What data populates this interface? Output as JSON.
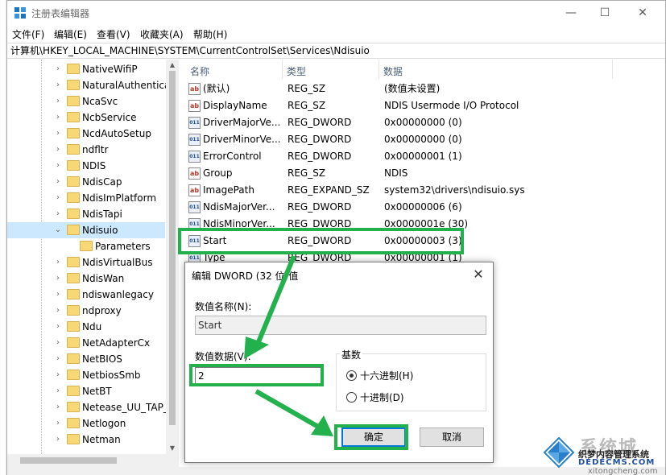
{
  "window": {
    "title": "注册表编辑器",
    "minimize_label": "—",
    "maximize_label": "☐",
    "close_label": "✕"
  },
  "menu": [
    "文件(F)",
    "编辑(E)",
    "查看(V)",
    "收藏夹(A)",
    "帮助(H)"
  ],
  "address": "计算机\\HKEY_LOCAL_MACHINE\\SYSTEM\\CurrentControlSet\\Services\\Ndisuio",
  "tree": {
    "items": [
      {
        "label": "NativeWifiP",
        "arrow": "›"
      },
      {
        "label": "NaturalAuthentica",
        "arrow": "›"
      },
      {
        "label": "NcaSvc",
        "arrow": "›"
      },
      {
        "label": "NcbService",
        "arrow": "›"
      },
      {
        "label": "NcdAutoSetup",
        "arrow": "›"
      },
      {
        "label": "ndfltr",
        "arrow": "›"
      },
      {
        "label": "NDIS",
        "arrow": "›"
      },
      {
        "label": "NdisCap",
        "arrow": "›"
      },
      {
        "label": "NdisImPlatform",
        "arrow": "›"
      },
      {
        "label": "NdisTapi",
        "arrow": "›"
      },
      {
        "label": "Ndisuio",
        "arrow": "⌄"
      },
      {
        "label": "Parameters",
        "arrow": ""
      },
      {
        "label": "NdisVirtualBus",
        "arrow": "›"
      },
      {
        "label": "NdisWan",
        "arrow": "›"
      },
      {
        "label": "ndiswanlegacy",
        "arrow": "›"
      },
      {
        "label": "ndproxy",
        "arrow": "›"
      },
      {
        "label": "Ndu",
        "arrow": "›"
      },
      {
        "label": "NetAdapterCx",
        "arrow": "›"
      },
      {
        "label": "NetBIOS",
        "arrow": "›"
      },
      {
        "label": "NetbiosSmb",
        "arrow": "›"
      },
      {
        "label": "NetBT",
        "arrow": "›"
      },
      {
        "label": "Netease_UU_TAP_",
        "arrow": "›"
      },
      {
        "label": "Netlogon",
        "arrow": "›"
      },
      {
        "label": "Netman",
        "arrow": "›"
      }
    ],
    "selected": "Ndisuio"
  },
  "list": {
    "headers": [
      "名称",
      "类型",
      "数据"
    ],
    "rows": [
      {
        "icon": "ab",
        "name": "(默认)",
        "type": "REG_SZ",
        "data": "(数值未设置)"
      },
      {
        "icon": "ab",
        "name": "DisplayName",
        "type": "REG_SZ",
        "data": "NDIS Usermode I/O Protocol"
      },
      {
        "icon": "011",
        "name": "DriverMajorVe...",
        "type": "REG_DWORD",
        "data": "0x00000000 (0)"
      },
      {
        "icon": "011",
        "name": "DriverMinorVe...",
        "type": "REG_DWORD",
        "data": "0x00000000 (0)"
      },
      {
        "icon": "011",
        "name": "ErrorControl",
        "type": "REG_DWORD",
        "data": "0x00000001 (1)"
      },
      {
        "icon": "ab",
        "name": "Group",
        "type": "REG_SZ",
        "data": "NDIS"
      },
      {
        "icon": "ab",
        "name": "ImagePath",
        "type": "REG_EXPAND_SZ",
        "data": "system32\\drivers\\ndisuio.sys"
      },
      {
        "icon": "011",
        "name": "NdisMajorVer...",
        "type": "REG_DWORD",
        "data": "0x00000006 (6)"
      },
      {
        "icon": "011",
        "name": "NdisMinorVer...",
        "type": "REG_DWORD",
        "data": "0x0000001e (30)"
      },
      {
        "icon": "011",
        "name": "Start",
        "type": "REG_DWORD",
        "data": "0x00000003 (3)"
      },
      {
        "icon": "011",
        "name": "Type",
        "type": "REG_DWORD",
        "data": "0x00000001 (1)"
      }
    ]
  },
  "dialog": {
    "title": "编辑 DWORD (32 位)值",
    "close_label": "✕",
    "name_label": "数值名称(N):",
    "name_value": "Start",
    "data_label": "数值数据(V):",
    "data_value": "2",
    "base_label": "基数",
    "hex_label": "十六进制(H)",
    "dec_label": "十进制(D)",
    "selected_base": "hex",
    "ok_label": "确定",
    "cancel_label": "取消"
  },
  "watermark": {
    "big": "系统城",
    "line1": "织梦内容管理系统",
    "line2": "DEDECMS.COM",
    "line3": "xitongcheng.com"
  },
  "colors": {
    "highlight_green": "#22b14c",
    "selection_blue": "#cce8ff",
    "accent_blue": "#0078d7"
  }
}
